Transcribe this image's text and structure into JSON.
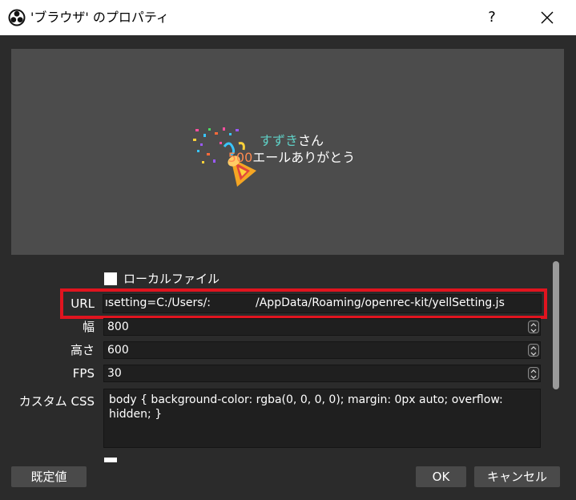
{
  "window": {
    "title": "'ブラウザ' のプロパティ",
    "help_label": "?",
    "close_icon": "close-icon"
  },
  "preview": {
    "name": "すずき",
    "name_suffix": "さん",
    "count": "500",
    "message": "エールありがとう",
    "name_color": "#5fd0c6",
    "count_color": "#ff8a50"
  },
  "form": {
    "local_file_label": "ローカルファイル",
    "local_file_checked": false,
    "url_label": "URL",
    "url_value_left": "ısetting=C:/Users/:",
    "url_value_right": "/AppData/Roaming/openrec-kit/yellSetting.js",
    "width_label": "幅",
    "width_value": "800",
    "height_label": "高さ",
    "height_value": "600",
    "fps_label": "FPS",
    "fps_value": "30",
    "css_label": "カスタム CSS",
    "css_value": "body { background-color: rgba(0, 0, 0, 0); margin: 0px auto; overflow:\nhidden; }"
  },
  "footer": {
    "defaults_label": "既定値",
    "ok_label": "OK",
    "cancel_label": "キャンセル"
  },
  "colors": {
    "highlight": "#e0141f",
    "background": "#2b2b2b",
    "preview_bg": "#4c4c4c"
  }
}
